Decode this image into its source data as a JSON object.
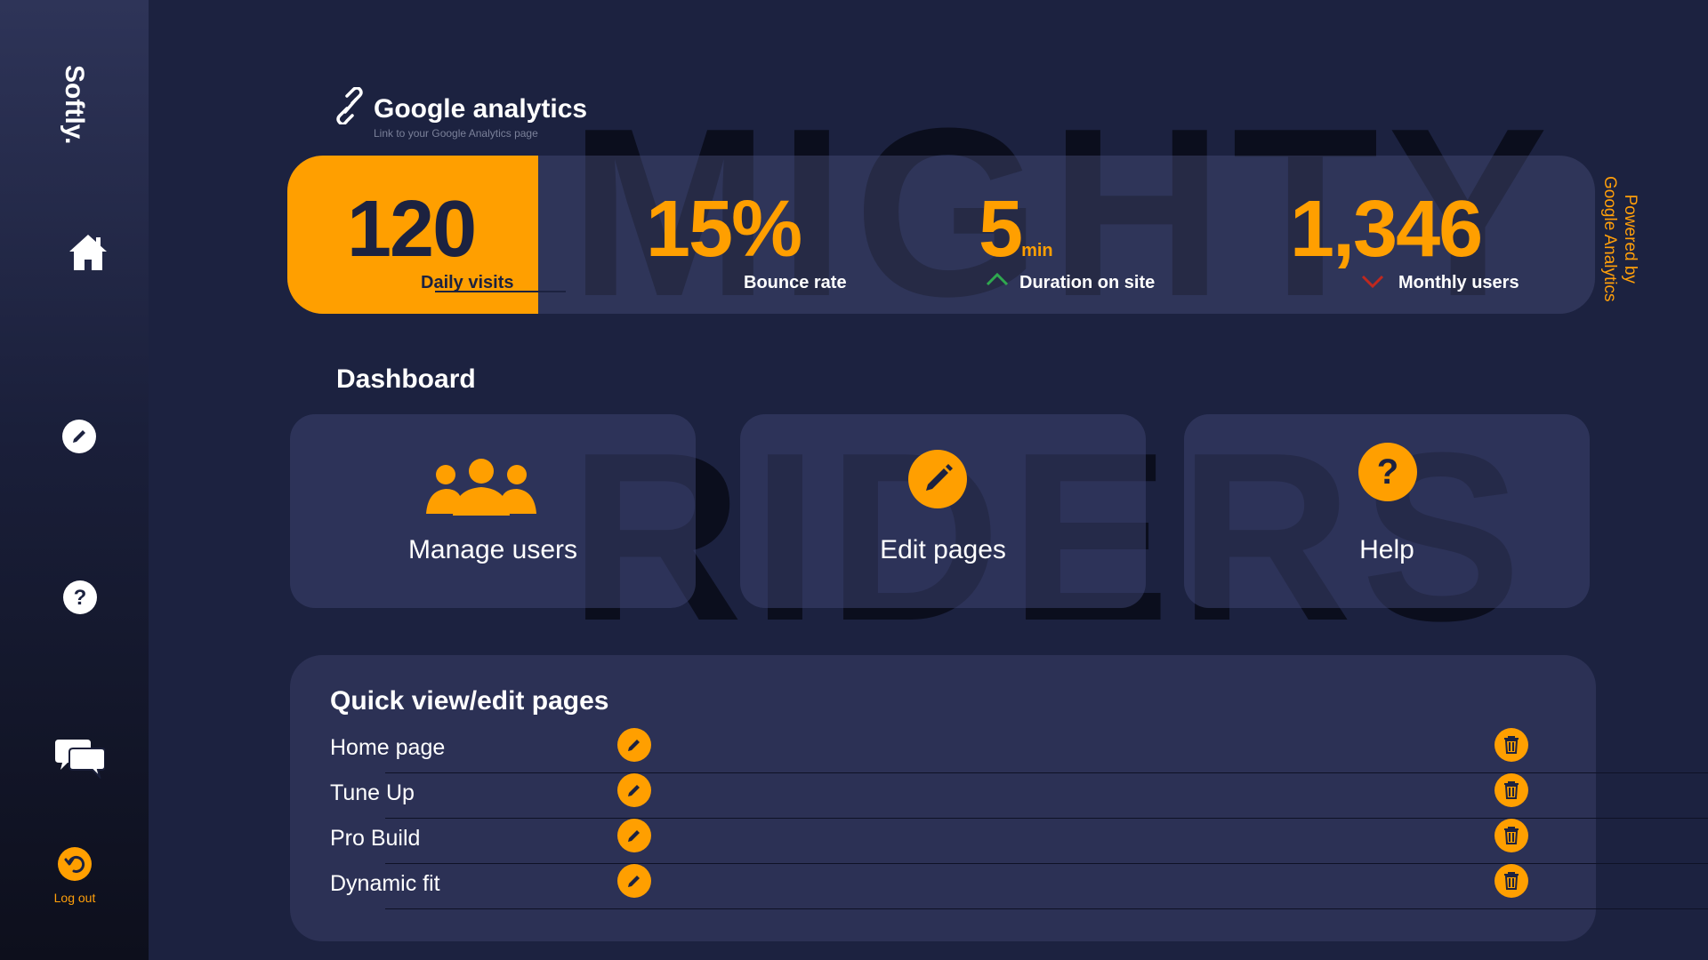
{
  "brand": "Softly.",
  "sidebar": {
    "icons": [
      "home-icon",
      "edit-icon",
      "help-icon",
      "chat-icon",
      "logout-icon"
    ],
    "logout_label": "Log out"
  },
  "watermark": {
    "line1": "MIGHTY",
    "line2": "RIDERS"
  },
  "analytics": {
    "title": "Google analytics",
    "subtitle": "Link to your Google Analytics page",
    "powered_by": [
      "Powered by",
      "Google Analytics"
    ],
    "stats": [
      {
        "value": "120",
        "unit": "",
        "label": "Daily visits",
        "trend": "none"
      },
      {
        "value": "15%",
        "unit": "",
        "label": "Bounce rate",
        "trend": "none"
      },
      {
        "value": "5",
        "unit": "min",
        "label": "Duration on site",
        "trend": "up"
      },
      {
        "value": "1,346",
        "unit": "",
        "label": "Monthly users",
        "trend": "down"
      }
    ]
  },
  "dashboard": {
    "title": "Dashboard",
    "cards": [
      {
        "label": "Manage users",
        "icon": "users-icon"
      },
      {
        "label": "Edit pages",
        "icon": "edit-icon"
      },
      {
        "label": "Help",
        "icon": "help-icon"
      }
    ]
  },
  "quick_view": {
    "title": "Quick view/edit pages",
    "pages": [
      "Home page",
      "Tune Up",
      "Pro Build",
      "Dynamic fit"
    ]
  },
  "colors": {
    "accent": "#ff9f00",
    "background": "#1c2240",
    "trend_up": "#2fa84f",
    "trend_down": "#c0281e"
  }
}
